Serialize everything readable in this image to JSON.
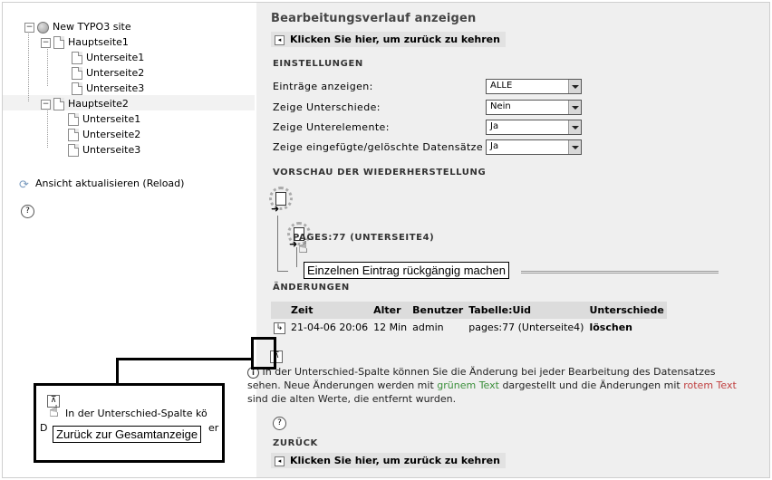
{
  "tree": {
    "root": "New TYPO3 site",
    "pages": [
      {
        "label": "Hauptseite1",
        "children": [
          "Unterseite1",
          "Unterseite2",
          "Unterseite3"
        ]
      },
      {
        "label": "Hauptseite2",
        "children": [
          "Unterseite1",
          "Unterseite2",
          "Unterseite3"
        ]
      }
    ],
    "expander_collapse": "−"
  },
  "left": {
    "reload_label": "Ansicht aktualisieren (Reload)",
    "help_glyph": "?"
  },
  "main": {
    "title": "Bearbeitungsverlauf anzeigen",
    "back_link": "Klicken Sie hier, um zurück zu kehren",
    "settings_heading": "EINSTELLUNGEN",
    "settings": [
      {
        "label": "Einträge anzeigen:",
        "value": "ALLE"
      },
      {
        "label": "Zeige Unterschiede:",
        "value": "Nein"
      },
      {
        "label": "Zeige Unterelemente:",
        "value": "Ja"
      },
      {
        "label": "Zeige eingefügte/gelöschte Datensätze",
        "value": "Ja"
      }
    ],
    "preview_heading": "VORSCHAU DER WIEDERHERSTELLUNG",
    "preview_record": "PAGES:77 (UNTERSEITE4)",
    "tooltip_undo": "Einzelnen Eintrag rückgängig machen",
    "changes_heading": "ÄNDERUNGEN",
    "columns": [
      "Zeit",
      "Alter",
      "Benutzer",
      "Tabelle:Uid",
      "Unterschiede"
    ],
    "rows": [
      {
        "time": "21-04-06 20:06",
        "age": "12 Min",
        "user": "admin",
        "table_uid": "pages:77 (Unterseite4)",
        "diff": "löschen"
      }
    ],
    "info_text_1": "In der Unterschied-Spalte können Sie die Änderung bei jeder Bearbeitung des Datensatzes sehen. Neue Änderungen werden mit ",
    "info_green": "grünem Text",
    "info_text_2": " dargestellt und die Änderungen mit ",
    "info_red": "rotem Text",
    "info_text_3": " sind die alten Werte, die entfernt wurden.",
    "back_heading": "ZURÜCK",
    "back_link_bottom": "Klicken Sie hier, um zurück zu kehren"
  },
  "zoom": {
    "text_line": "In der Unterschied-Spalte kö",
    "text_partial_1": "D",
    "text_partial_2": "er",
    "tooltip": "Zurück zur Gesamtanzeige"
  },
  "icons": {
    "back_arrow": "◂",
    "row_arrow": "↳",
    "return_glyph": "⊼",
    "info_glyph": "i",
    "undo_arrow": "➜",
    "cursor": "☝",
    "reload_glyph": "⟳"
  },
  "colors": {
    "green": "#3b8f3b",
    "red": "#c04040",
    "panel": "#efefef",
    "header_bg": "#dcdcdc"
  }
}
